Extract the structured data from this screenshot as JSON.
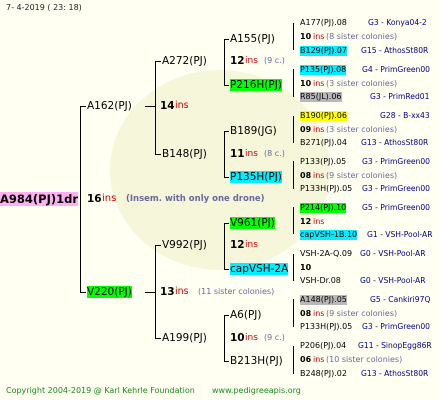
{
  "header": "7-  4-2019 (  23:  18)",
  "footer": {
    "copyright": "Copyright 2004-2019 @ Karl Kehrle Foundation",
    "site": "www.pedigreeapis.org"
  },
  "root": {
    "id": "A984(PJ)1dr",
    "ins": "16",
    "ins_word": "ins",
    "note": "(Insem. with only one drone)"
  },
  "gen1": {
    "top": {
      "id": "A162(PJ)",
      "ins": "14",
      "ins_word": "ins"
    },
    "bottom": {
      "id": "V220(PJ)",
      "ins": "13",
      "ins_word": "ins",
      "note": "(11 sister colonies)"
    }
  },
  "gen2": [
    {
      "id": "A272(PJ)",
      "ins": "12",
      "ins_word": "ins",
      "note": "(9 c.)"
    },
    {
      "id": "B148(PJ)",
      "ins": "11",
      "ins_word": "ins",
      "note": "(8 c.)"
    },
    {
      "id": "V992(PJ)",
      "ins": "12",
      "ins_word": "ins",
      "note": ""
    },
    {
      "id": "A199(PJ)",
      "ins": "10",
      "ins_word": "ins",
      "note": "(9 c.)"
    }
  ],
  "gen3": [
    "A155(PJ)",
    "P216H(PJ)",
    "B189(JG)",
    "P135H(PJ)",
    "V961(PJ)",
    "capVSH-2A",
    "A6(PJ)",
    "B213H(PJ)"
  ],
  "gen3_ins": [
    {
      "num": "10",
      "word": "ins",
      "note": "(8 sister colonies)"
    },
    {
      "num": "10",
      "word": "ins",
      "note": "(3 sister colonies)"
    },
    {
      "num": "09",
      "word": "ins",
      "note": "(3 sister colonies)"
    },
    {
      "num": "08",
      "word": "ins",
      "note": "(9 sister colonies)"
    },
    {
      "num": "12",
      "word": "ins",
      "note": ""
    },
    {
      "num": "10",
      "word": "",
      "note": ""
    },
    {
      "num": "08",
      "word": "ins",
      "note": "(9 sister colonies)"
    },
    {
      "num": "06",
      "word": "ins",
      "note": "(10 sister colonies)"
    }
  ],
  "gen4": [
    {
      "id": "A177(PJ).08",
      "breeder": "G3 - Konya04-2"
    },
    {
      "id": "B129(PJ).07",
      "breeder": "G15 - AthosSt80R"
    },
    {
      "id": "P135(PJ).08",
      "breeder": "G4 - PrimGreen00"
    },
    {
      "id": "R85(JL).06",
      "breeder": "G3 - PrimRed01"
    },
    {
      "id": "B190(PJ).06",
      "breeder": "G28 - B-xx43"
    },
    {
      "id": "B271(PJ).04",
      "breeder": "G13 - AthosSt80R"
    },
    {
      "id": "P133(PJ).05",
      "breeder": "G3 - PrimGreen00"
    },
    {
      "id": "P133H(PJ).05",
      "breeder": "G3 - PrimGreen00"
    },
    {
      "id": "P214(PJ).10",
      "breeder": "G5 - PrimGreen00"
    },
    {
      "id": "capVSH-1B.10",
      "breeder": "G1 - VSH-Pool-AR"
    },
    {
      "id": "VSH-2A-Q.09",
      "breeder": "G0 - VSH-Pool-AR"
    },
    {
      "id": "VSH-Dr.08",
      "breeder": "G0 - VSH-Pool-AR"
    },
    {
      "id": "A148(PJ).05",
      "breeder": "G5 - Cankiri97Q"
    },
    {
      "id": "P133H(PJ).05",
      "breeder": "G3 - PrimGreen00"
    },
    {
      "id": "P206(PJ).04",
      "breeder": "G11 - SinopEgg86R"
    },
    {
      "id": "B248(PJ).02",
      "breeder": "G13 - AthosSt80R"
    }
  ]
}
